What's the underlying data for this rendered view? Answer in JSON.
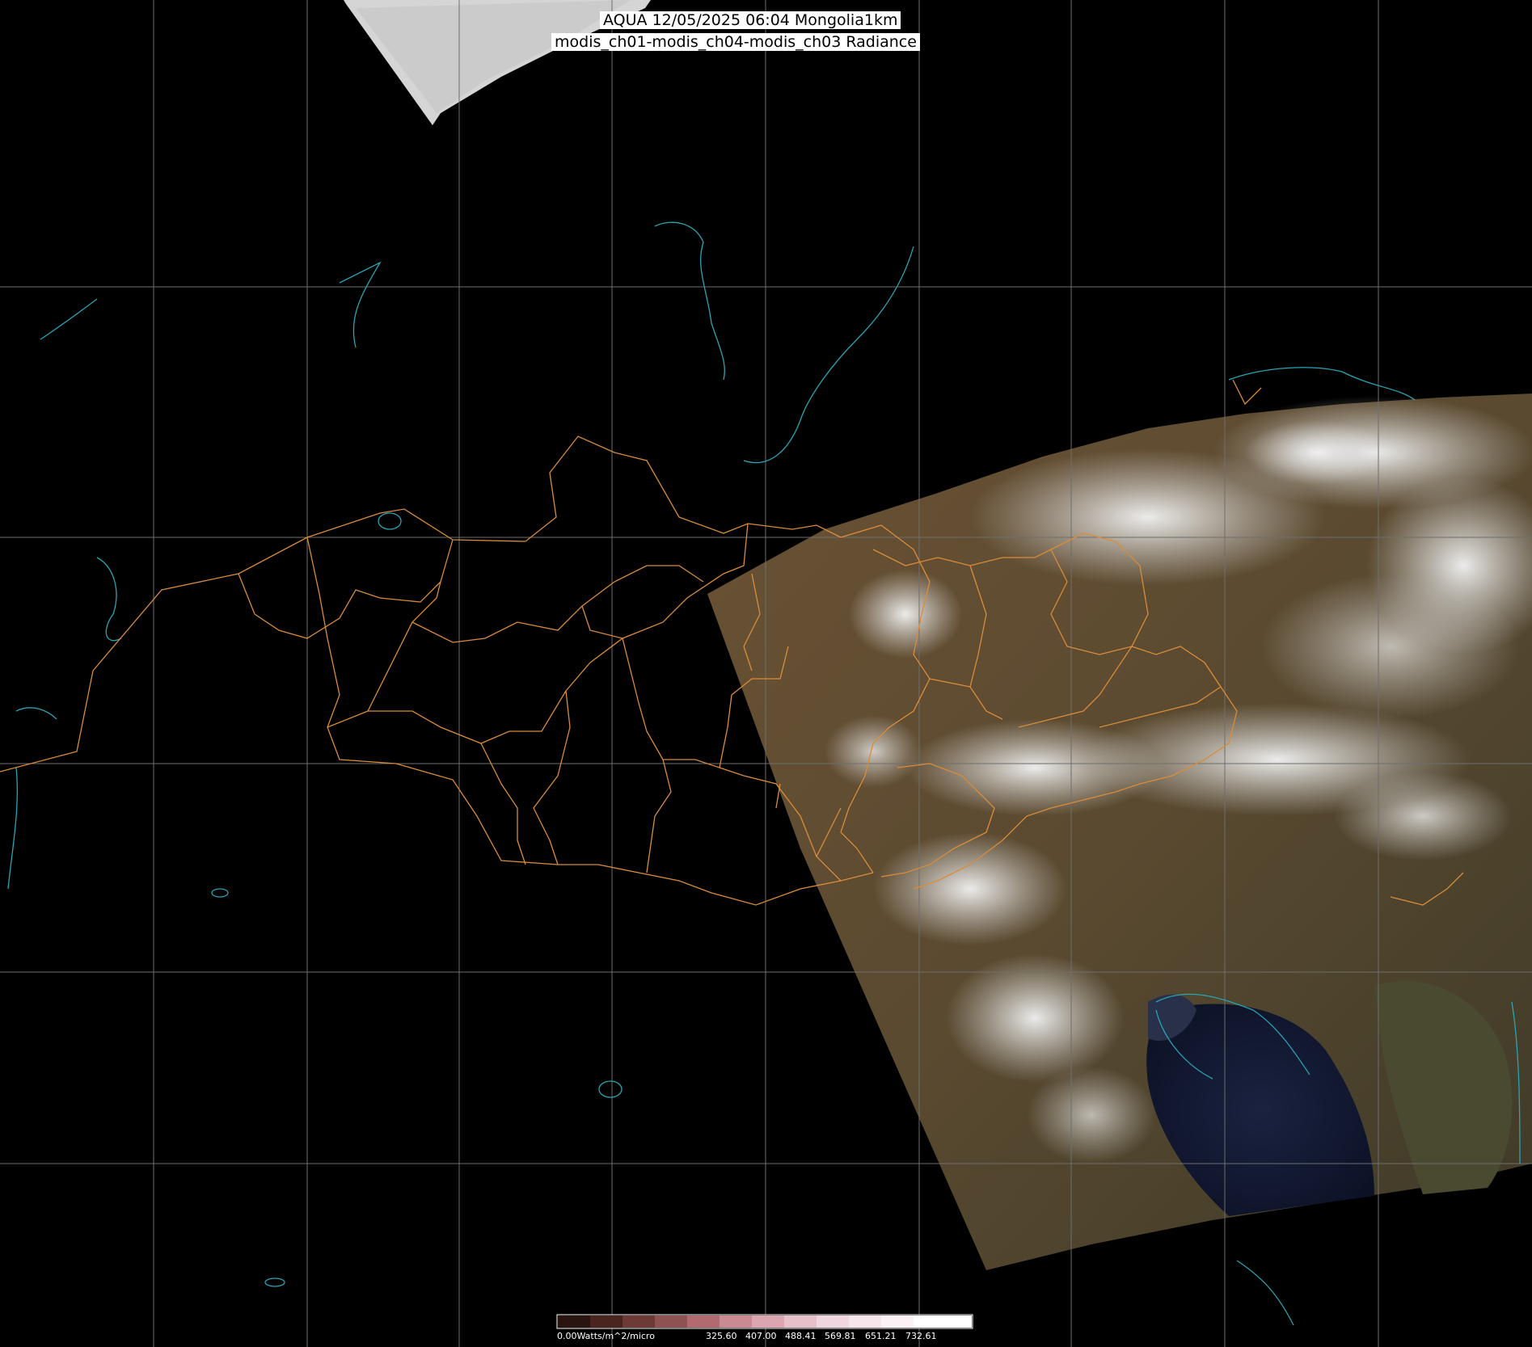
{
  "title": {
    "line1": "AQUA 12/05/2025 06:04 Mongolia1km",
    "line2": "modis_ch01-modis_ch04-modis_ch03 Radiance"
  },
  "colorbar": {
    "unit_label": "0.00Watts/m^2/micro",
    "ticks": [
      "325.60",
      "407.00",
      "488.41",
      "569.81",
      "651.21",
      "732.61"
    ]
  },
  "colors": {
    "background": "#000000",
    "graticule": "#6e6e6e",
    "admin_borders": "#d98c3a",
    "coastline": "#2aa3b3",
    "title_bg": "#ffffff"
  }
}
